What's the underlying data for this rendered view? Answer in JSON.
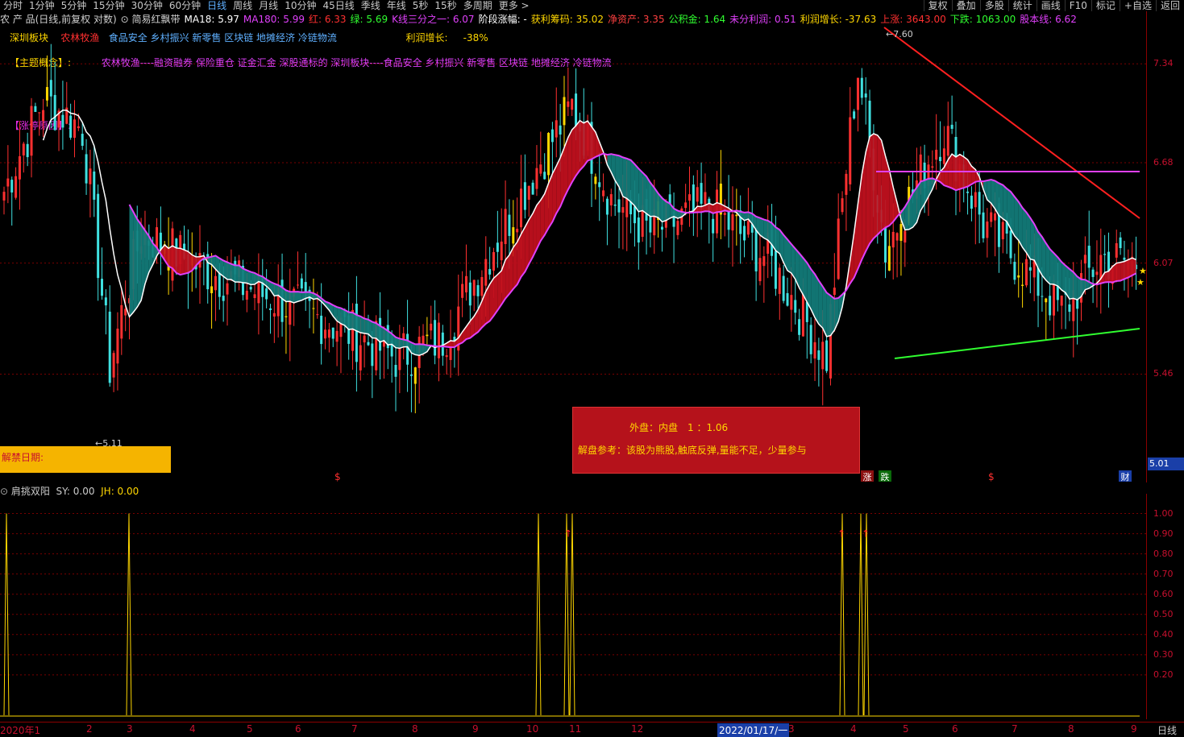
{
  "toolbar": {
    "periods": [
      "分时",
      "1分钟",
      "5分钟",
      "15分钟",
      "30分钟",
      "60分钟",
      "日线",
      "周线",
      "月线",
      "10分钟",
      "45日线",
      "季线",
      "年线",
      "5秒",
      "15秒",
      "多周期",
      "更多 >"
    ],
    "active_period": "日线",
    "right": [
      "复权",
      "叠加",
      "多股",
      "统计",
      "画线",
      "F10",
      "标记",
      "+自选",
      "返回"
    ]
  },
  "info_row": [
    {
      "text": "农 产 品(日线,前复权 对数)",
      "color": "#d0d0d0"
    },
    {
      "text": "⊙ 简易红飘带",
      "color": "#d0d0d0"
    },
    {
      "text": "MA18: 5.97",
      "color": "#ffffff"
    },
    {
      "text": "MA180: 5.99",
      "color": "#e040fb"
    },
    {
      "text": "红: 6.33",
      "color": "#ff3030"
    },
    {
      "text": "绿: 5.69",
      "color": "#30ff30"
    },
    {
      "text": "K线三分之一: 6.07",
      "color": "#e040fb"
    },
    {
      "text": "阶段涨幅: -",
      "color": "#ffffff"
    },
    {
      "text": "获利筹码: 35.02",
      "color": "#ffd700"
    },
    {
      "text": "净资产: 3.35",
      "color": "#ff4040"
    },
    {
      "text": "公积金: 1.64",
      "color": "#30ff30"
    },
    {
      "text": "未分利润: 0.51",
      "color": "#e040fb"
    },
    {
      "text": "利润增长: -37.63",
      "color": "#ffd700"
    },
    {
      "text": "上涨: 3643.00",
      "color": "#ff3030"
    },
    {
      "text": "下跌: 1063.00",
      "color": "#30ff30"
    },
    {
      "text": "股本线: 6.62",
      "color": "#e040fb"
    }
  ],
  "concept": {
    "sector_label": "深圳板块",
    "sector_red": "农林牧渔",
    "sector_blue": "食品安全 乡村振兴 新零售 区块链 地摊经济 冷链物流",
    "profit_label": "利润增长:",
    "profit_value": "-38%",
    "theme_label": "【主题概念】:",
    "theme_text": "农林牧渔----融资融券 保险重仓 证金汇金 深股通标的 深圳板块----食品安全 乡村振兴 新零售 区块链 地摊经济 冷链物流",
    "reason_label": "【涨停原因】:"
  },
  "unlock_label": "解禁日期:",
  "info_box": {
    "line1": "外盘：内盘　1 ：1.06",
    "line2": "解盘参考：该股为熊股,触底反弹,量能不足，少量参与"
  },
  "markers": {
    "s1": "$",
    "s2": "$",
    "zhang": "涨",
    "die": "跌",
    "cai": "财"
  },
  "price_axis": {
    "labels": [
      "7.34",
      "6.68",
      "6.07",
      "5.46"
    ],
    "current": "5.01",
    "high_mark": "7.60",
    "low_mark": "5.11"
  },
  "sub_indicator": {
    "name": "肩挑双阳",
    "sy": "SY: 0.00",
    "jh": "JH: 0.00",
    "labels": [
      "1.00",
      "0.90",
      "0.80",
      "0.70",
      "0.60",
      "0.50",
      "0.40",
      "0.30",
      "0.20"
    ]
  },
  "date_axis": {
    "labels": [
      "2020年1",
      "2",
      "3",
      "4",
      "5",
      "6",
      "7",
      "8",
      "9",
      "10",
      "11",
      "12",
      "2022/01/17/一",
      "3",
      "4",
      "5",
      "6",
      "7",
      "8",
      "9"
    ],
    "right_label": "日线"
  },
  "chart_data": {
    "type": "candlestick",
    "title": "农 产 品(日线,前复权 对数)",
    "ylim": [
      5.0,
      7.6
    ],
    "y_ticks": [
      7.34,
      6.68,
      6.07,
      5.46
    ],
    "high": 7.6,
    "low": 5.11,
    "indicators": {
      "MA18": 5.97,
      "MA180": 5.99,
      "红": 6.33,
      "绿": 5.69,
      "K线三分之一": 6.07,
      "股本线": 6.62
    },
    "sub_series": {
      "name": "肩挑双阳",
      "ylim": [
        0,
        1.05
      ],
      "spike_value": 1.0,
      "SY": 0.0,
      "JH": 0.0
    }
  }
}
